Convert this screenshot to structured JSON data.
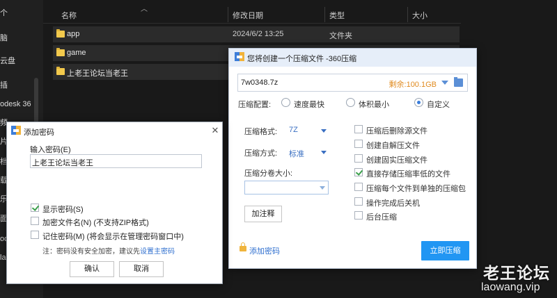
{
  "explorer": {
    "nav_items": [
      "个",
      "脑",
      "云盘",
      "插",
      "odesk 36",
      "频",
      "片",
      "档",
      "载",
      "乐",
      "面",
      "ode",
      "la"
    ],
    "columns": {
      "name": "名称",
      "date": "修改日期",
      "type": "类型",
      "size": "大小"
    },
    "files": [
      {
        "name": "app",
        "date": "2024/6/2 13:25",
        "type": "文件夹"
      },
      {
        "name": "game",
        "date": "",
        "type": ""
      },
      {
        "name": "上老王论坛当老王",
        "date": "",
        "type": ""
      }
    ]
  },
  "zip_dialog": {
    "title": "您将创建一个压缩文件 -360压缩",
    "path": "7w0348.7z",
    "remaining": "剩余:100.1GB",
    "config_label": "压缩配置:",
    "radios": [
      {
        "label": "速度最快",
        "checked": false
      },
      {
        "label": "体积最小",
        "checked": false
      },
      {
        "label": "自定义",
        "checked": true
      }
    ],
    "format_label": "压缩格式:",
    "format_value": "7Z",
    "method_label": "压缩方式:",
    "method_value": "标准",
    "volume_label": "压缩分卷大小:",
    "volume_value": "",
    "comment_button": "加注释",
    "options": [
      {
        "label": "压缩后删除源文件",
        "checked": false
      },
      {
        "label": "创建自解压文件",
        "checked": false
      },
      {
        "label": "创建固实压缩文件",
        "checked": false
      },
      {
        "label": "直接存储压缩率低的文件",
        "checked": true
      },
      {
        "label": "压缩每个文件到单独的压缩包",
        "checked": false
      },
      {
        "label": "操作完成后关机",
        "checked": false
      },
      {
        "label": "后台压缩",
        "checked": false
      }
    ],
    "add_password": "添加密码",
    "compress_button": "立即压缩"
  },
  "password_dialog": {
    "title": "添加密码",
    "input_label": "输入密码(E)",
    "input_value": "上老王论坛当老王",
    "checks": [
      {
        "label": "显示密码(S)",
        "checked": true
      },
      {
        "label": "加密文件名(N) (不支持ZIP格式)",
        "checked": false
      },
      {
        "label": "记住密码(M) (将会显示在管理密码窗口中)",
        "checked": false
      }
    ],
    "note_prefix": "注：密码没有安全加密，建议先",
    "note_link": "设置主密码",
    "ok_button": "确认",
    "cancel_button": "取消"
  },
  "watermark": {
    "title": "老王论坛",
    "url": "laowang.vip"
  },
  "colors": {
    "accent": "#2196f3",
    "remaining": "#e08a1e",
    "link": "#2f6fcf",
    "folder": "#f2c94c"
  }
}
